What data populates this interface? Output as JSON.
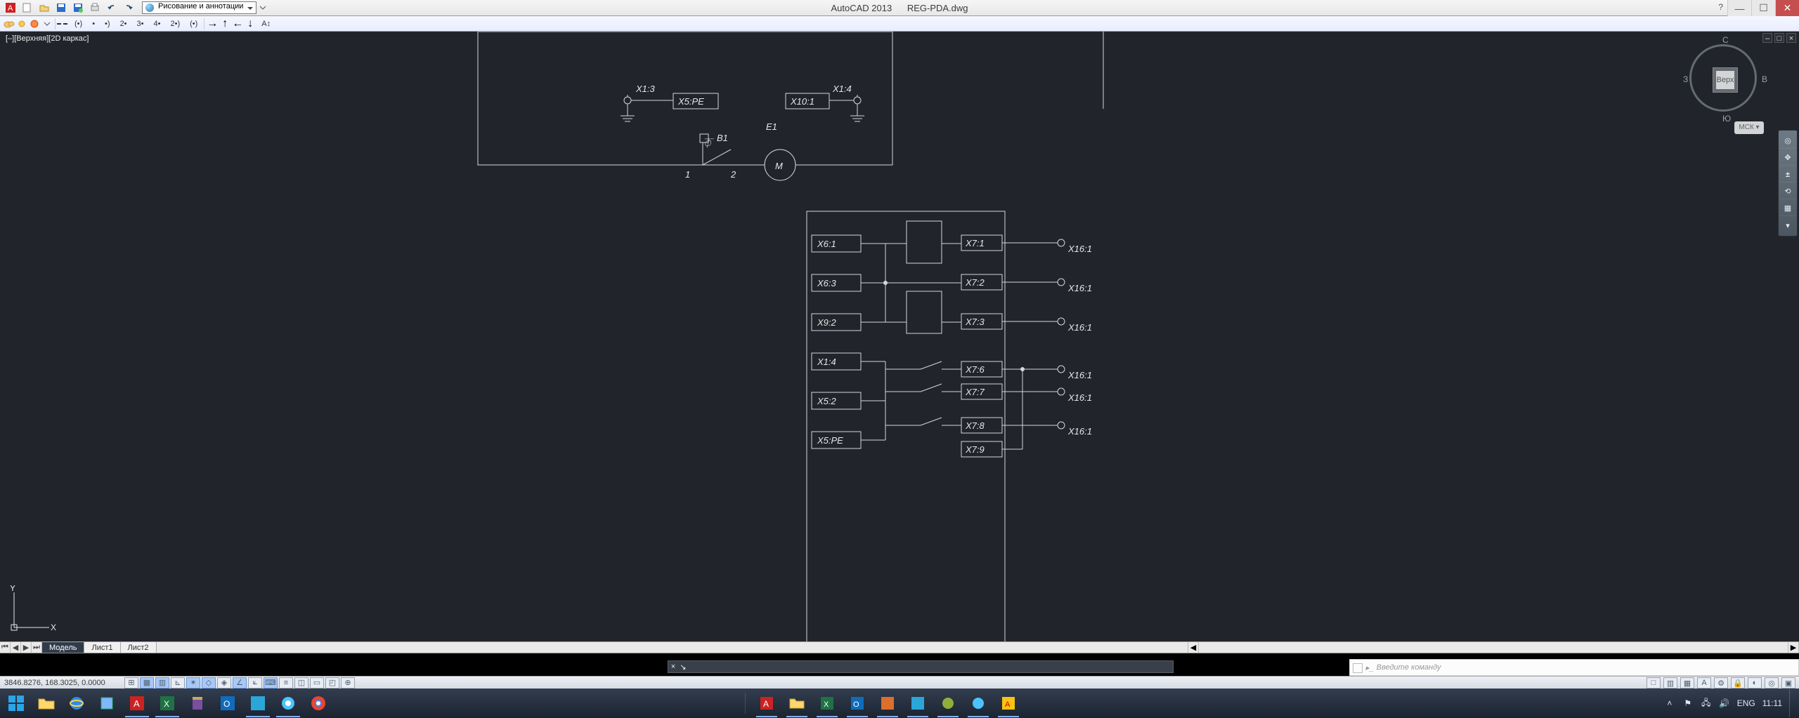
{
  "app": {
    "name": "AutoCAD 2013",
    "file": "REG-PDA.dwg"
  },
  "workspace": "Рисование и аннотации",
  "viewport_label": "[–][Верхняя][2D каркас]",
  "viewcube": {
    "top": "С",
    "right": "В",
    "bottom": "Ю",
    "left": "З",
    "center": "Верх",
    "home": "МСК ▾"
  },
  "coords": "3846.8276, 168.3025, 0.0000",
  "tabs": {
    "model": "Модель",
    "sheet1": "Лист1",
    "sheet2": "Лист2"
  },
  "cmd_placeholder": "Введите команду",
  "tray": {
    "lang": "ENG",
    "time": "11:11"
  },
  "menu_items": [
    "(•)",
    "•",
    "•)",
    "2•",
    "3•",
    "4•",
    "2•)",
    "(•)"
  ],
  "schematic": {
    "top": {
      "x13": "X1:3",
      "x5pe": "X5:PE",
      "x14": "X1:4",
      "x10_1": "X10:1",
      "e1": "E1",
      "b1": "B1",
      "m": "M",
      "t1": "1",
      "t2": "2",
      "t3": "⏁"
    },
    "col_left": [
      "X6:1",
      "X6:3",
      "X9:2",
      "X1:4",
      "X5:2",
      "X5:PE"
    ],
    "col_mid": [
      "X7:1",
      "X7:2",
      "X7:3",
      "X7:6",
      "X7:7",
      "X7:8",
      "X7:9"
    ],
    "col_right": [
      "X16:1",
      "X16:1",
      "X16:1",
      "X16:1",
      "X16:1",
      "X16:1"
    ]
  }
}
